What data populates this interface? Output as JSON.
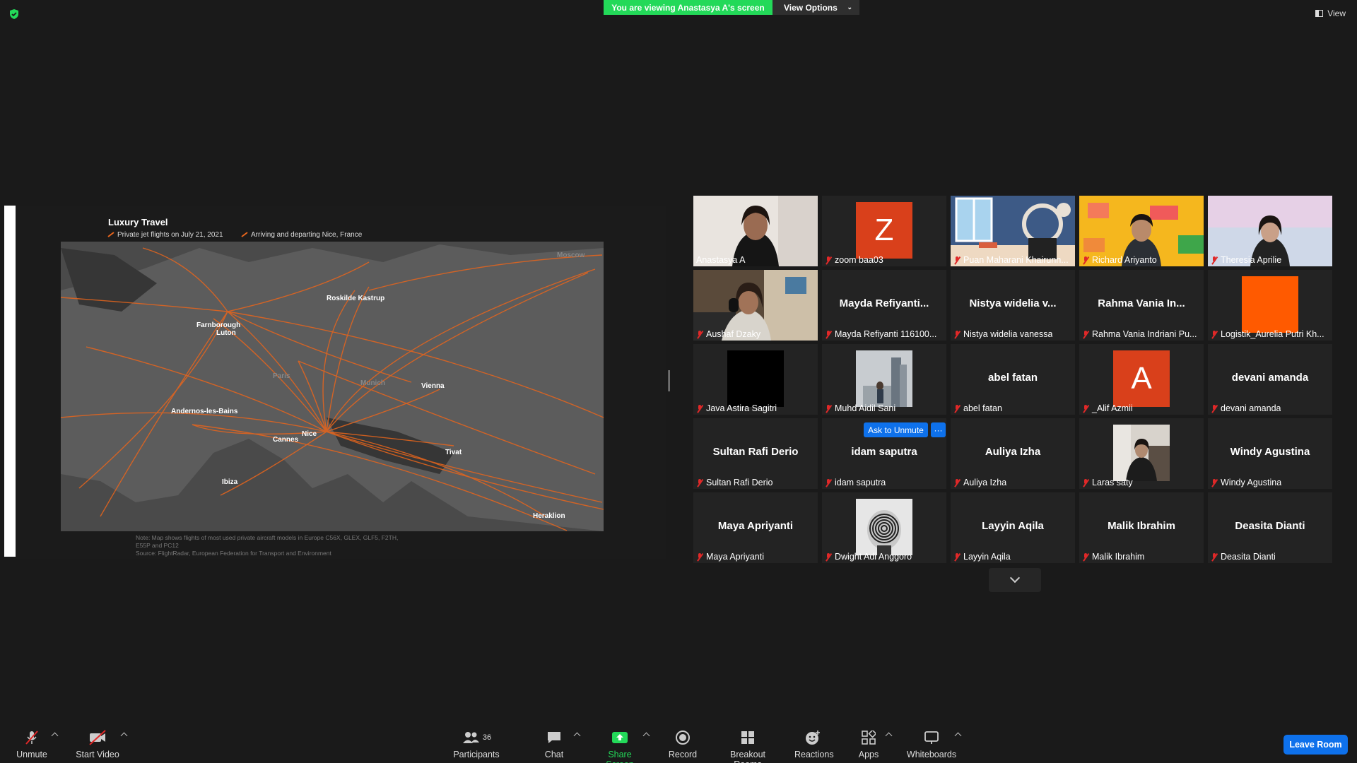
{
  "banner": {
    "viewing": "You are viewing Anastasya A's screen",
    "view_options": "View Options"
  },
  "top_view": "View",
  "map": {
    "title": "Luxury Travel",
    "legend_1": "Private jet flights on July 21, 2021",
    "legend_2": "Arriving and departing Nice, France",
    "cities": [
      "Moscow",
      "Roskilde  Kastrup",
      "Farnborough",
      "Luton",
      "Paris",
      "Munich",
      "Vienna",
      "Andernos-les-Bains",
      "Nice",
      "Cannes",
      "Tivat",
      "Ibiza",
      "Heraklion"
    ],
    "note": "Note: Map shows flights of most used private aircraft models in Europe C56X, GLEX, GLF5, F2TH,",
    "note2": "E55P and PC12",
    "source": "Source: FlightRadar, European Federation for Transport and Environment"
  },
  "tiles": [
    {
      "big": "",
      "name": "Anastasya A",
      "muted": false,
      "video": "person1"
    },
    {
      "big": "",
      "name": "zoom baa03",
      "muted": true,
      "avatar": "Z",
      "avatar_color": "#d9401b"
    },
    {
      "big": "",
      "name": "Puan Maharani Khairunn...",
      "muted": true,
      "video": "illus"
    },
    {
      "big": "",
      "name": "Richard Ariyanto",
      "muted": true,
      "video": "person2"
    },
    {
      "big": "",
      "name": "Theresia Aprilie",
      "muted": true,
      "video": "person3"
    },
    {
      "big": "",
      "name": "Aushaf Dzaky",
      "muted": true,
      "video": "person4"
    },
    {
      "big": "Mayda  Refiyanti...",
      "name": "Mayda Refiyanti 116100...",
      "muted": true
    },
    {
      "big": "Nistya  widelia  v...",
      "name": "Nistya widelia vanessa",
      "muted": true
    },
    {
      "big": "Rahma Vania In...",
      "name": "Rahma Vania Indriani Pu...",
      "muted": true
    },
    {
      "big": "",
      "name": "Logistik_Aurelia Putri Kh...",
      "muted": true,
      "avatar": "",
      "avatar_color": "#ff5a00"
    },
    {
      "big": "",
      "name": "Java Astira Sagitri",
      "muted": true,
      "avatar": "",
      "avatar_color": "#000000"
    },
    {
      "big": "",
      "name": "Muhd Aidil Sani",
      "muted": true,
      "video": "city"
    },
    {
      "big": "abel fatan",
      "name": "abel fatan",
      "muted": true
    },
    {
      "big": "",
      "name": "_Alif Azmii",
      "muted": true,
      "avatar": "A",
      "avatar_color": "#d9401b"
    },
    {
      "big": "devani amanda",
      "name": "devani amanda",
      "muted": true
    },
    {
      "big": "Sultan Rafi Derio",
      "name": "Sultan Rafi Derio",
      "muted": true
    },
    {
      "big": "idam saputra",
      "name": "idam saputra",
      "muted": true
    },
    {
      "big": "Auliya Izha",
      "name": "Auliya Izha",
      "muted": true
    },
    {
      "big": "",
      "name": "Laras saty",
      "muted": true,
      "video": "person5"
    },
    {
      "big": "Windy Agustina",
      "name": "Windy Agustina",
      "muted": true
    },
    {
      "big": "Maya Apriyanti",
      "name": "Maya Apriyanti",
      "muted": true
    },
    {
      "big": "",
      "name": "Dwight Adi Anggoro",
      "muted": true,
      "video": "spiral"
    },
    {
      "big": "Layyin Aqila",
      "name": "Layyin Aqila",
      "muted": true
    },
    {
      "big": "Malik Ibrahim",
      "name": "Malik Ibrahim",
      "muted": true
    },
    {
      "big": "Deasita Dianti",
      "name": "Deasita Dianti",
      "muted": true
    }
  ],
  "ask_unmute": "Ask to Unmute",
  "ask_more": "···",
  "toolbar": {
    "unmute": "Unmute",
    "start_video": "Start Video",
    "participants": "Participants",
    "participants_count": "36",
    "chat": "Chat",
    "share_screen": "Share Screen",
    "record": "Record",
    "breakout": "Breakout Rooms",
    "reactions": "Reactions",
    "apps": "Apps",
    "whiteboards": "Whiteboards",
    "leave": "Leave Room"
  },
  "colors": {
    "accent_green": "#23d959",
    "active_speaker": "#c9e85e",
    "blue": "#0e71eb",
    "muted_red": "#e02828"
  }
}
